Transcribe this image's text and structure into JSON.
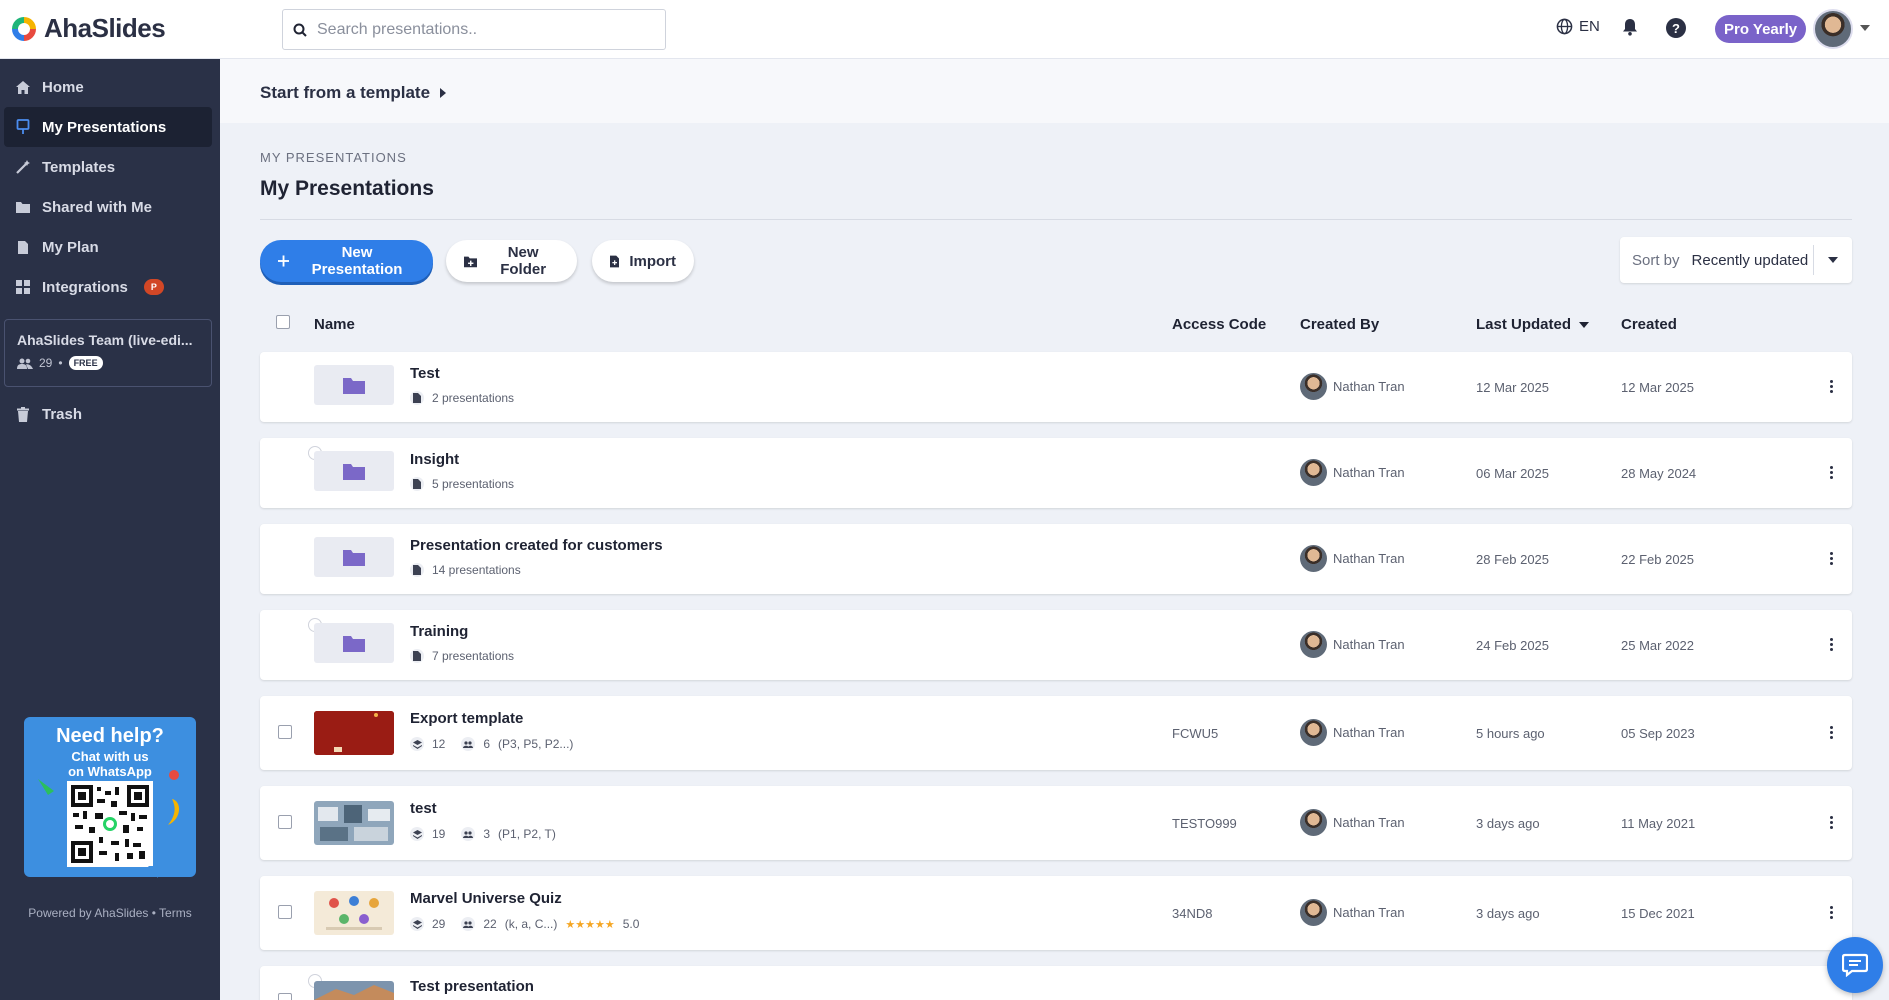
{
  "app": {
    "name": "AhaSlides"
  },
  "search": {
    "placeholder": "Search presentations.."
  },
  "header": {
    "language": "EN",
    "plan_badge": "Pro Yearly"
  },
  "sidebar": {
    "items": [
      {
        "label": "Home",
        "icon": "home-icon"
      },
      {
        "label": "My Presentations",
        "icon": "presentation-icon",
        "active": true
      },
      {
        "label": "Templates",
        "icon": "magic-wand-icon"
      },
      {
        "label": "Shared with Me",
        "icon": "shared-folder-icon"
      },
      {
        "label": "My Plan",
        "icon": "document-icon"
      },
      {
        "label": "Integrations",
        "icon": "grid-icon"
      },
      {
        "label": "Trash",
        "icon": "trash-icon"
      }
    ],
    "integrations_badge": "P",
    "team": {
      "name": "AhaSlides Team (live-edi...",
      "members": "29",
      "plan": "FREE"
    },
    "help_card": {
      "title": "Need help?",
      "line1": "Chat with us",
      "line2": "on WhatsApp"
    },
    "footer": {
      "powered": "Powered by AhaSlides",
      "separator": " • ",
      "terms": "Terms"
    }
  },
  "main": {
    "template_link": "Start from a template",
    "breadcrumb": "MY PRESENTATIONS",
    "title": "My Presentations",
    "buttons": {
      "new_presentation": "New Presentation",
      "new_folder": "New Folder",
      "import": "Import"
    },
    "sort": {
      "label": "Sort by",
      "value": "Recently updated"
    },
    "columns": {
      "name": "Name",
      "access_code": "Access Code",
      "created_by": "Created By",
      "last_updated": "Last Updated",
      "created": "Created"
    },
    "rows": [
      {
        "type": "folder",
        "name": "Test",
        "count": "2 presentations",
        "creator": "Nathan Tran",
        "updated": "12 Mar 2025",
        "created": "12 Mar 2025"
      },
      {
        "type": "folder",
        "shared": true,
        "name": "Insight",
        "count": "5 presentations",
        "creator": "Nathan Tran",
        "updated": "06 Mar 2025",
        "created": "28 May 2024"
      },
      {
        "type": "folder",
        "name": "Presentation created for customers",
        "count": "14 presentations",
        "creator": "Nathan Tran",
        "updated": "28 Feb 2025",
        "created": "22 Feb 2025"
      },
      {
        "type": "folder",
        "shared": true,
        "name": "Training",
        "count": "7 presentations",
        "creator": "Nathan Tran",
        "updated": "24 Feb 2025",
        "created": "25 Mar 2022"
      },
      {
        "type": "presentation",
        "name": "Export template",
        "slides": "12",
        "participants": "6",
        "participant_names": "(P3, P5, P2...)",
        "code": "FCWU5",
        "creator": "Nathan Tran",
        "updated": "5 hours ago",
        "created": "05 Sep 2023",
        "thumb_color": "#9a1c14"
      },
      {
        "type": "presentation",
        "name": "test",
        "slides": "19",
        "participants": "3",
        "participant_names": "(P1, P2, T)",
        "code": "TESTO999",
        "creator": "Nathan Tran",
        "updated": "3 days ago",
        "created": "11 May 2021",
        "thumb_color": "#6f8aa4"
      },
      {
        "type": "presentation",
        "name": "Marvel Universe Quiz",
        "slides": "29",
        "participants": "22",
        "participant_names": "(k, a, C...)",
        "rating_stars": "★★★★★",
        "rating": "5.0",
        "code": "34ND8",
        "creator": "Nathan Tran",
        "updated": "3 days ago",
        "created": "15 Dec 2021",
        "thumb_color": "#f4ead8"
      },
      {
        "type": "presentation",
        "shared": true,
        "name": "Test presentation",
        "code": "",
        "creator": "",
        "updated": "",
        "created": "",
        "thumb_color": "#c48b5c"
      }
    ]
  },
  "colors": {
    "sidebar": "#2a3147",
    "primary": "#2f7ee8",
    "pro_badge": "#7a63c9",
    "folder": "#7b68c8"
  }
}
